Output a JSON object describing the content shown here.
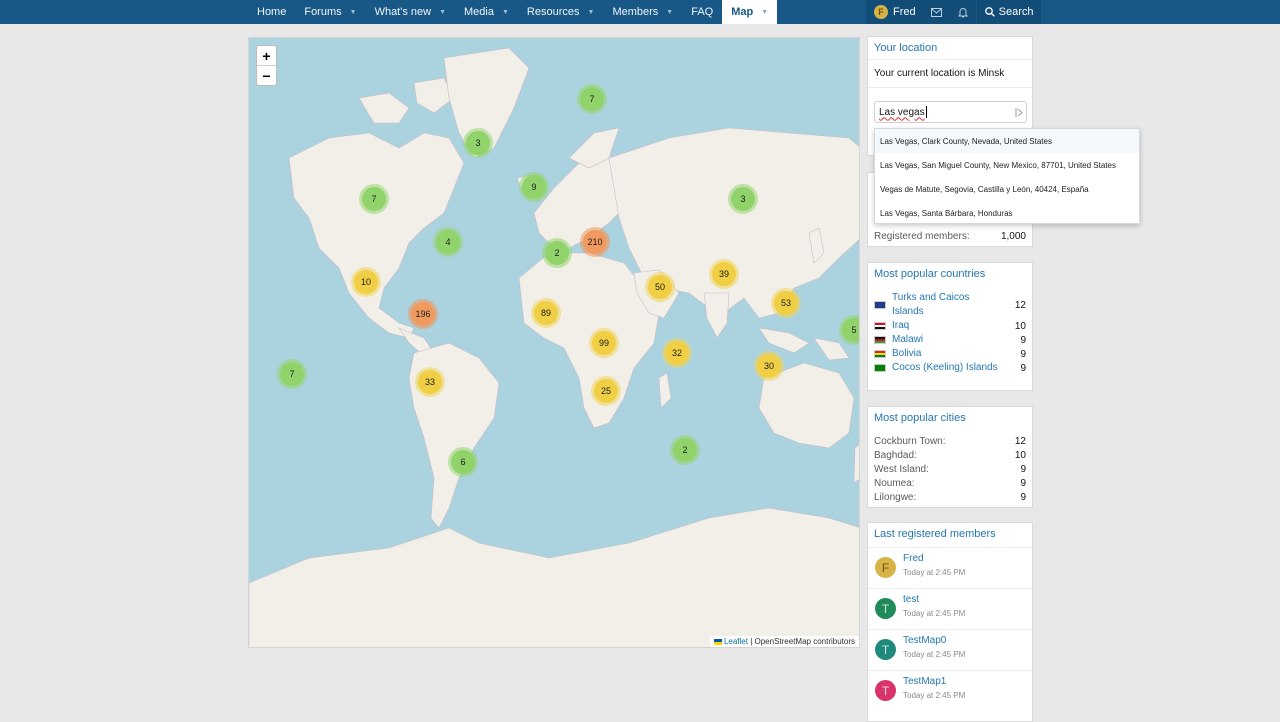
{
  "nav": {
    "items": [
      {
        "label": "Home",
        "chevron": false
      },
      {
        "label": "Forums",
        "chevron": true
      },
      {
        "label": "What's new",
        "chevron": true
      },
      {
        "label": "Media",
        "chevron": true
      },
      {
        "label": "Resources",
        "chevron": true
      },
      {
        "label": "Members",
        "chevron": true
      },
      {
        "label": "FAQ",
        "chevron": false
      },
      {
        "label": "Map",
        "chevron": true,
        "active": true
      }
    ],
    "user_name": "Fred",
    "user_initial": "F",
    "search_label": "Search",
    "chevron_glyph": "▼"
  },
  "map": {
    "zoom_in": "+",
    "zoom_out": "−",
    "clusters": [
      "7",
      "3",
      "9",
      "3",
      "7",
      "4",
      "2",
      "210",
      "10",
      "196",
      "89",
      "50",
      "39",
      "53",
      "5",
      "99",
      "32",
      "30",
      "7",
      "33",
      "25",
      "6",
      "2"
    ],
    "attribution_leaflet": "Leaflet",
    "attribution_rest": "| OpenStreetMap contributors"
  },
  "location": {
    "title": "Your location",
    "current": "Your current location is Minsk",
    "input_value": "Las vegas",
    "suggestions": [
      "Las Vegas, Clark County, Nevada, United States",
      "Las Vegas, San Miguel County, New Mexico, 87701, United States",
      "Vegas de Matute, Segovia, Castilla y León, 40424, España",
      "Las Vegas, Santa Bárbara, Honduras"
    ]
  },
  "stats": {
    "registered_label": "Registered members:",
    "registered_value": "1,000"
  },
  "countries": {
    "title": "Most popular countries",
    "items": [
      {
        "name": "Turks and Caicos Islands",
        "count": "12",
        "flag": "#1f3b8a"
      },
      {
        "name": "Iraq",
        "count": "10",
        "flag": "#ce1126"
      },
      {
        "name": "Malawi",
        "count": "9",
        "flag": "#111111"
      },
      {
        "name": "Bolivia",
        "count": "9",
        "flag": "#d52b1e"
      },
      {
        "name": "Cocos (Keeling) Islands",
        "count": "9",
        "flag": "#008000"
      }
    ]
  },
  "cities": {
    "title": "Most popular cities",
    "items": [
      {
        "name": "Cockburn Town:",
        "count": "12"
      },
      {
        "name": "Baghdad:",
        "count": "10"
      },
      {
        "name": "West Island:",
        "count": "9"
      },
      {
        "name": "Noumea:",
        "count": "9"
      },
      {
        "name": "Lilongwe:",
        "count": "9"
      }
    ]
  },
  "members": {
    "title": "Last registered members",
    "items": [
      {
        "name": "Fred",
        "time": "Today at 2:45 PM",
        "initial": "F",
        "color": "#d7b447",
        "text_color": "#6b5413"
      },
      {
        "name": "test",
        "time": "Today at 2:45 PM",
        "initial": "T",
        "color": "#1f8a5a",
        "text_color": "#cdeedd"
      },
      {
        "name": "TestMap0",
        "time": "Today at 2:45 PM",
        "initial": "T",
        "color": "#1f8a7a",
        "text_color": "#cdeee8"
      },
      {
        "name": "TestMap1",
        "time": "Today at 2:45 PM",
        "initial": "T",
        "color": "#d8336a",
        "text_color": "#fbd3e1"
      }
    ]
  }
}
